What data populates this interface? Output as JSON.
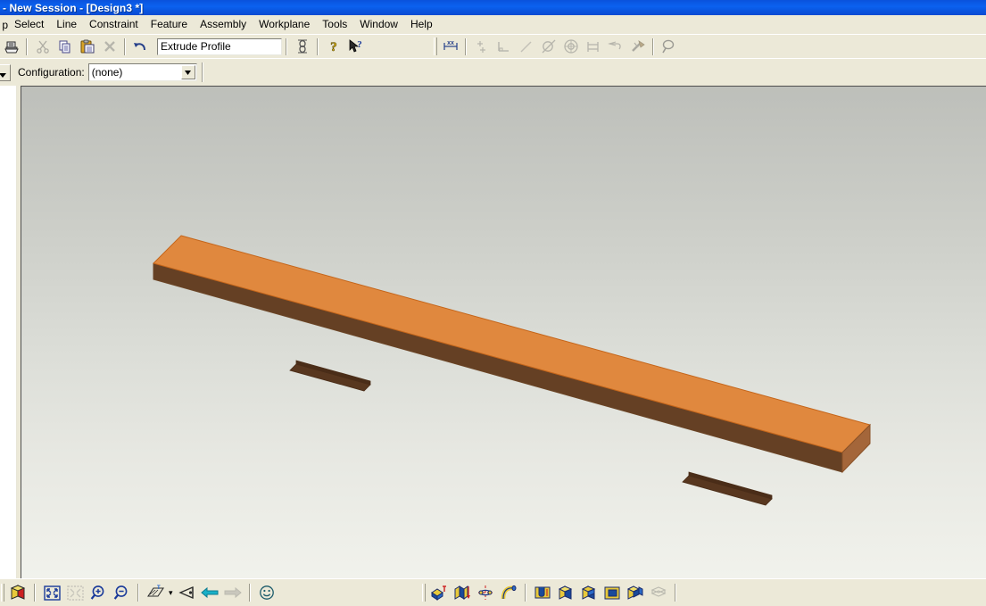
{
  "window": {
    "title": "- New Session  - [Design3 *]",
    "titlebar_color": "#0a57e2"
  },
  "menubar": {
    "clipped_first_item": "p",
    "items": [
      {
        "label": "Select"
      },
      {
        "label": "Line"
      },
      {
        "label": "Constraint"
      },
      {
        "label": "Feature"
      },
      {
        "label": "Assembly"
      },
      {
        "label": "Workplane"
      },
      {
        "label": "Tools"
      },
      {
        "label": "Window"
      },
      {
        "label": "Help"
      }
    ]
  },
  "toolbar": {
    "print_icon": "printer-icon",
    "cut_icon": "scissors-icon",
    "copy_icon": "copy-icon",
    "paste_icon": "paste-icon",
    "delete_icon": "delete-x-icon",
    "undo_icon": "undo-arrow-icon",
    "operation_field_value": "Extrude Profile",
    "dimension_icon": "linear-dimension-icon",
    "help_icon": "help-question-icon",
    "context_help_icon": "help-pointer-icon",
    "constraints": [
      {
        "icon": "dimension-xx-icon",
        "enabled": true
      },
      {
        "icon": "coincident-icon",
        "enabled": false
      },
      {
        "icon": "perpendicular-icon",
        "enabled": false
      },
      {
        "icon": "collinear-line-icon",
        "enabled": false
      },
      {
        "icon": "tangent-icon",
        "enabled": false
      },
      {
        "icon": "concentric-icon",
        "enabled": false
      },
      {
        "icon": "equal-length-icon",
        "enabled": false
      },
      {
        "icon": "horizontal-icon",
        "enabled": false
      },
      {
        "icon": "fix-anchor-icon",
        "enabled": false
      }
    ],
    "inspect_icon": "magnifier-inspect-icon"
  },
  "configbar": {
    "label": "Configuration:",
    "selected": "(none)",
    "options": [
      "(none)"
    ],
    "dropdown_icon": "chevron-down-icon"
  },
  "viewport": {
    "background_top_color": "#bdbfba",
    "background_bottom_color": "#f1f2ec",
    "model": {
      "name": "extruded-slotted-bar",
      "top_face_color": "#e0883e",
      "front_face_color": "#654024",
      "end_face_color": "#a4663a",
      "slot_floor_color": "#58371f",
      "edge_color": "#c4651a",
      "slot_count": 2
    }
  },
  "bottombar": {
    "left_group": [
      {
        "icon": "isometric-view-cube-icon",
        "enabled": true
      },
      {
        "icon": "zoom-fit-icon",
        "enabled": true
      },
      {
        "icon": "zoom-selection-icon",
        "enabled": false
      },
      {
        "icon": "zoom-in-icon",
        "enabled": true
      },
      {
        "icon": "zoom-out-icon",
        "enabled": true
      },
      {
        "icon": "workplane-icon",
        "enabled": true
      },
      {
        "icon": "view-direction-icon",
        "enabled": true
      },
      {
        "icon": "previous-view-arrow-icon",
        "enabled": true
      },
      {
        "icon": "next-view-arrow-icon",
        "enabled": false
      },
      {
        "icon": "shading-smiley-icon",
        "enabled": true
      }
    ],
    "feature_group": [
      {
        "icon": "extrude-feature-icon",
        "enabled": true
      },
      {
        "icon": "project-feature-icon",
        "enabled": true
      },
      {
        "icon": "revolve-feature-icon",
        "enabled": true
      },
      {
        "icon": "sweep-feature-icon",
        "enabled": true
      }
    ],
    "boolean_group": [
      {
        "icon": "pocket-feature-icon",
        "enabled": true
      },
      {
        "icon": "boolean-add-icon",
        "enabled": true
      },
      {
        "icon": "boolean-subtract-icon",
        "enabled": true
      },
      {
        "icon": "boolean-intersect-icon",
        "enabled": true
      },
      {
        "icon": "split-part-icon",
        "enabled": true
      },
      {
        "icon": "shell-part-icon",
        "enabled": false
      }
    ]
  }
}
